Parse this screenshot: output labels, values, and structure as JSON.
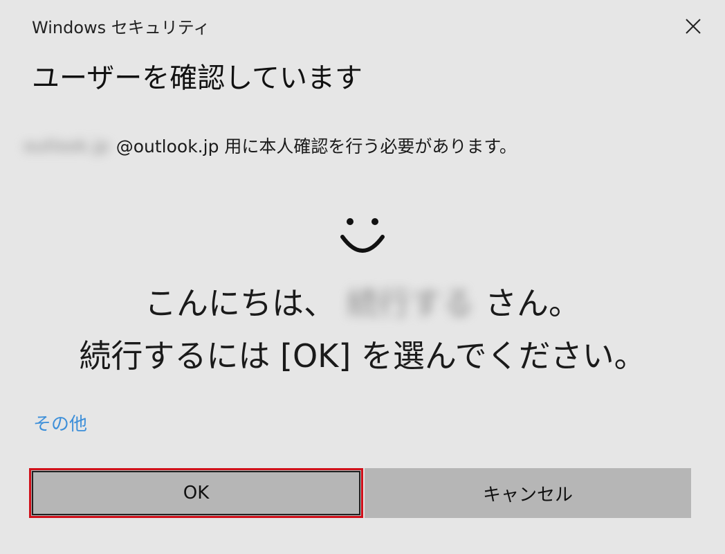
{
  "window": {
    "title": "Windows セキュリティ",
    "close_icon": "close-icon"
  },
  "heading": "ユーザーを確認しています",
  "account": {
    "name": "outlook.jp",
    "suffix": "@outlook.jp 用に本人確認を行う必要があります。"
  },
  "face_icon": "smiley-face-icon",
  "greeting": {
    "prefix": "こんにちは、",
    "user": "続行する",
    "suffix": "さん。",
    "line2": "続行するには [OK] を選んでください。"
  },
  "more_link": "その他",
  "buttons": {
    "ok": "OK",
    "cancel": "キャンセル"
  },
  "colors": {
    "background": "#e6e6e6",
    "button": "#b6b6b6",
    "link": "#3d8fd9",
    "highlight": "#d0101a"
  }
}
